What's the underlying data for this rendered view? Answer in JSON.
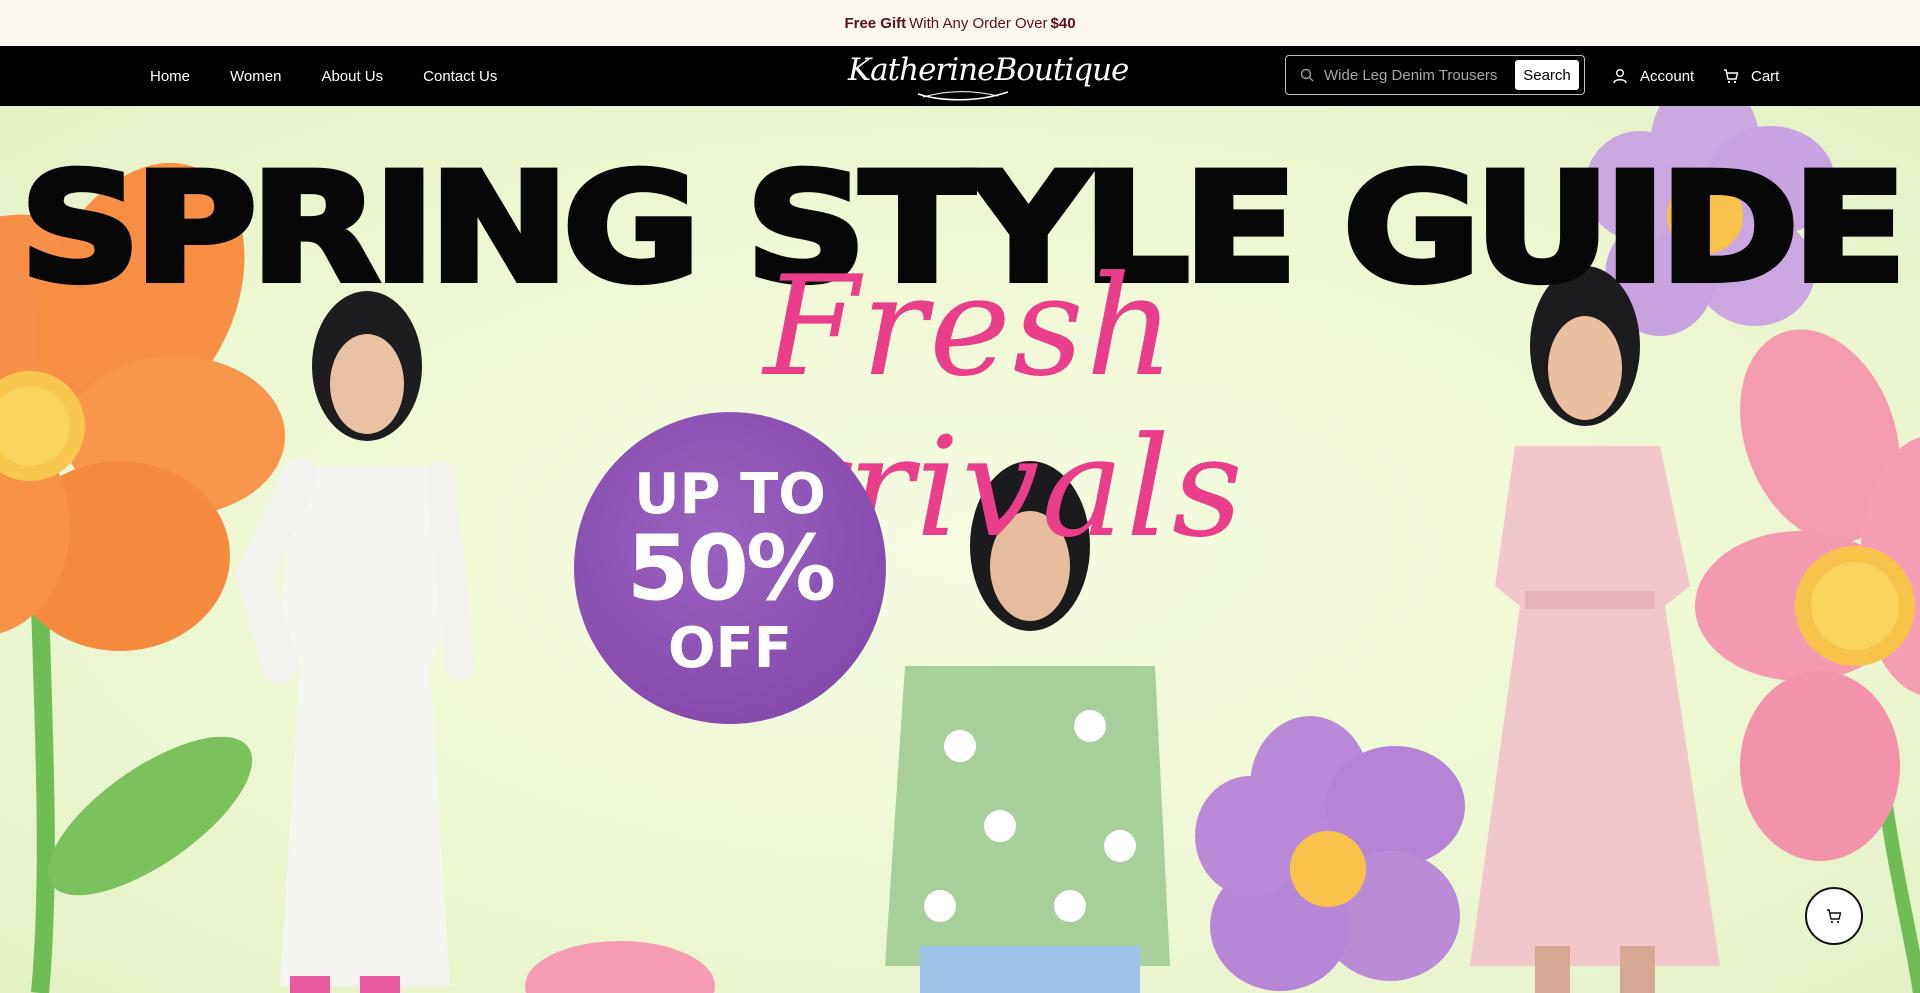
{
  "announcement": {
    "bold_lead": "Free Gift",
    "middle": "With Any Order Over",
    "bold_amount": "$40"
  },
  "nav": {
    "items": [
      "Home",
      "Women",
      "About Us",
      "Contact Us"
    ]
  },
  "logo": {
    "text": "KatherineBoutique"
  },
  "search": {
    "placeholder": "Wide Leg Denim Trousers",
    "button_label": "Search",
    "icon": "search-icon"
  },
  "account": {
    "label": "Account",
    "icon": "user-icon"
  },
  "cart": {
    "label": "Cart",
    "icon": "cart-icon"
  },
  "hero": {
    "headline": "SPRING STYLE GUIDE",
    "script": "Fresh arrivals",
    "badge": {
      "line1": "UP TO",
      "line2": "50%",
      "line3": "OFF"
    },
    "colors": {
      "script": "#ea3d8a",
      "badge": "#8a4fb4",
      "headline": "#070707"
    }
  },
  "floating_cart": {
    "icon": "cart-icon"
  }
}
